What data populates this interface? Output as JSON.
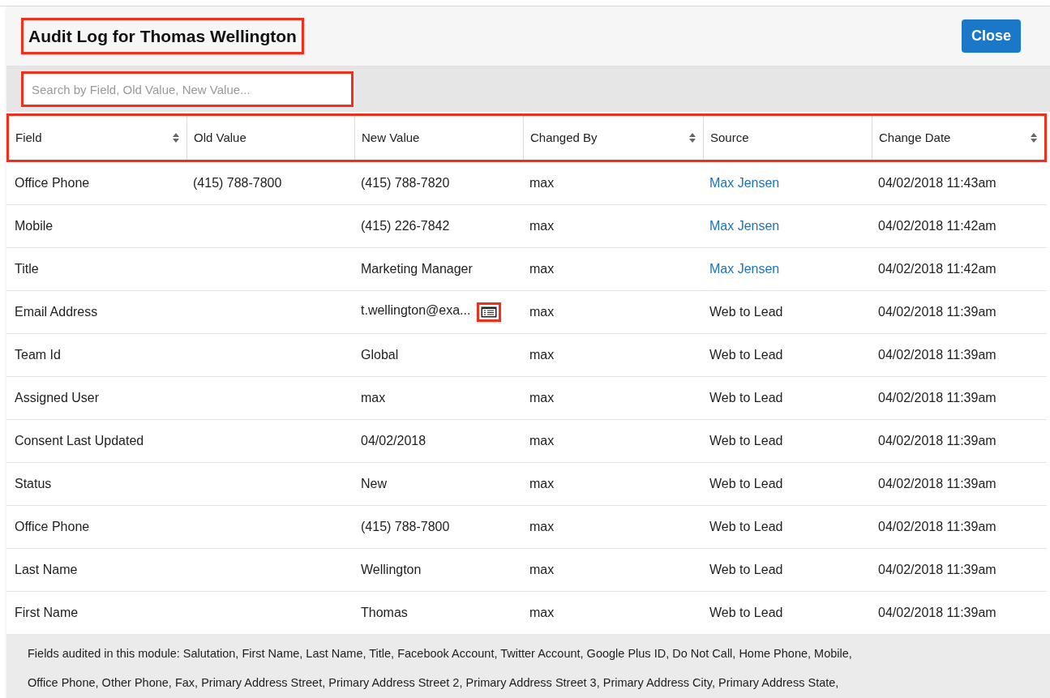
{
  "dialog": {
    "title": "Audit Log for Thomas Wellington",
    "close_button": "Close"
  },
  "search": {
    "placeholder": "Search by Field, Old Value, New Value..."
  },
  "table": {
    "columns": [
      {
        "label": "Field",
        "sortable": true
      },
      {
        "label": "Old Value",
        "sortable": false
      },
      {
        "label": "New Value",
        "sortable": false
      },
      {
        "label": "Changed By",
        "sortable": true
      },
      {
        "label": "Source",
        "sortable": false
      },
      {
        "label": "Change Date",
        "sortable": true
      }
    ],
    "rows": [
      {
        "field": "Office Phone",
        "old_value": "(415) 788-7800",
        "new_value": "(415) 788-7820",
        "new_value_detail": false,
        "changed_by": "max",
        "source": "Max Jensen",
        "source_is_link": true,
        "change_date": "04/02/2018 11:43am"
      },
      {
        "field": "Mobile",
        "old_value": "",
        "new_value": "(415) 226-7842",
        "new_value_detail": false,
        "changed_by": "max",
        "source": "Max Jensen",
        "source_is_link": true,
        "change_date": "04/02/2018 11:42am"
      },
      {
        "field": "Title",
        "old_value": "",
        "new_value": "Marketing Manager",
        "new_value_detail": false,
        "changed_by": "max",
        "source": "Max Jensen",
        "source_is_link": true,
        "change_date": "04/02/2018 11:42am"
      },
      {
        "field": "Email Address",
        "old_value": "",
        "new_value": "t.wellington@exa...",
        "new_value_detail": true,
        "changed_by": "max",
        "source": "Web to Lead",
        "source_is_link": false,
        "change_date": "04/02/2018 11:39am"
      },
      {
        "field": "Team Id",
        "old_value": "",
        "new_value": "Global",
        "new_value_detail": false,
        "changed_by": "max",
        "source": "Web to Lead",
        "source_is_link": false,
        "change_date": "04/02/2018 11:39am"
      },
      {
        "field": "Assigned User",
        "old_value": "",
        "new_value": "max",
        "new_value_detail": false,
        "changed_by": "max",
        "source": "Web to Lead",
        "source_is_link": false,
        "change_date": "04/02/2018 11:39am"
      },
      {
        "field": "Consent Last Updated",
        "old_value": "",
        "new_value": "04/02/2018",
        "new_value_detail": false,
        "changed_by": "max",
        "source": "Web to Lead",
        "source_is_link": false,
        "change_date": "04/02/2018 11:39am"
      },
      {
        "field": "Status",
        "old_value": "",
        "new_value": "New",
        "new_value_detail": false,
        "changed_by": "max",
        "source": "Web to Lead",
        "source_is_link": false,
        "change_date": "04/02/2018 11:39am"
      },
      {
        "field": "Office Phone",
        "old_value": "",
        "new_value": "(415) 788-7800",
        "new_value_detail": false,
        "changed_by": "max",
        "source": "Web to Lead",
        "source_is_link": false,
        "change_date": "04/02/2018 11:39am"
      },
      {
        "field": "Last Name",
        "old_value": "",
        "new_value": "Wellington",
        "new_value_detail": false,
        "changed_by": "max",
        "source": "Web to Lead",
        "source_is_link": false,
        "change_date": "04/02/2018 11:39am"
      },
      {
        "field": "First Name",
        "old_value": "",
        "new_value": "Thomas",
        "new_value_detail": false,
        "changed_by": "max",
        "source": "Web to Lead",
        "source_is_link": false,
        "change_date": "04/02/2018 11:39am"
      }
    ]
  },
  "footer": {
    "lines": [
      "Fields audited in this module: Salutation, First Name, Last Name, Title, Facebook Account, Twitter Account, Google Plus ID, Do Not Call, Home Phone, Mobile,",
      "Office Phone, Other Phone, Fax, Primary Address Street, Primary Address Street 2, Primary Address Street 3, Primary Address City, Primary Address State,"
    ]
  }
}
